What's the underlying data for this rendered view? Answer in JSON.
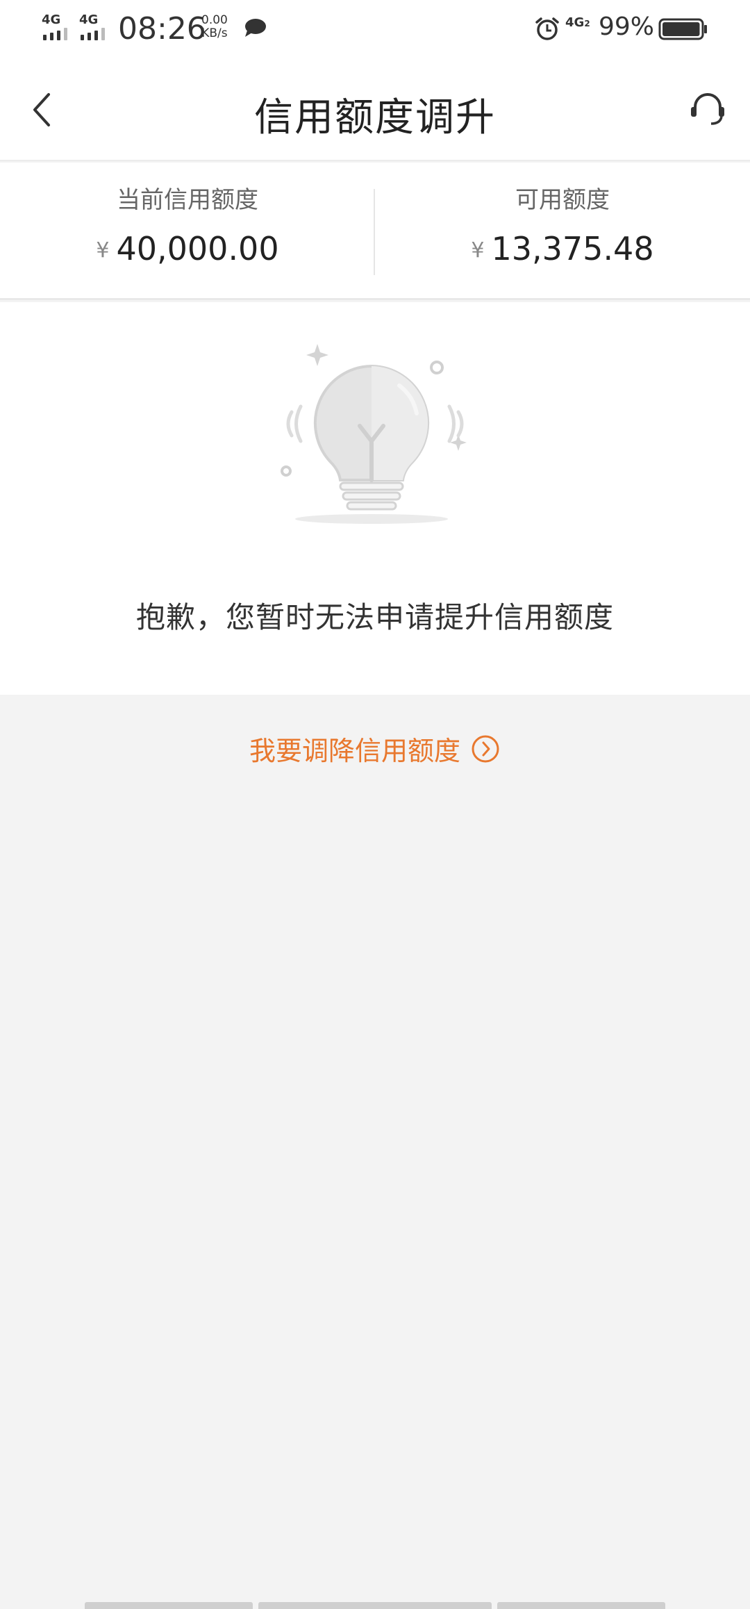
{
  "status_bar": {
    "sim1_network": "4G",
    "sim2_network": "4G",
    "time": "08:26",
    "net_speed_value": "0.00",
    "net_speed_unit": "KB/s",
    "data_network": "4G",
    "data_network_sub": "2",
    "battery_percent": "99%",
    "battery_level": 0.99
  },
  "nav": {
    "title": "信用额度调升",
    "back_icon": "chevron-left-icon",
    "service_icon": "headset-icon"
  },
  "credit": {
    "current_label": "当前信用额度",
    "current_currency": "¥",
    "current_amount": "40,000.00",
    "available_label": "可用额度",
    "available_currency": "¥",
    "available_amount": "13,375.48"
  },
  "empty_state": {
    "icon": "lightbulb-icon",
    "message": "抱歉，您暂时无法申请提升信用额度"
  },
  "lower_credit": {
    "label": "我要调降信用额度",
    "icon": "circle-arrow-right-icon"
  },
  "colors": {
    "accent": "#e8782e",
    "page_background": "#f3f3f3",
    "card_background": "#ffffff",
    "illustration_gray": "#d6d6d6"
  }
}
